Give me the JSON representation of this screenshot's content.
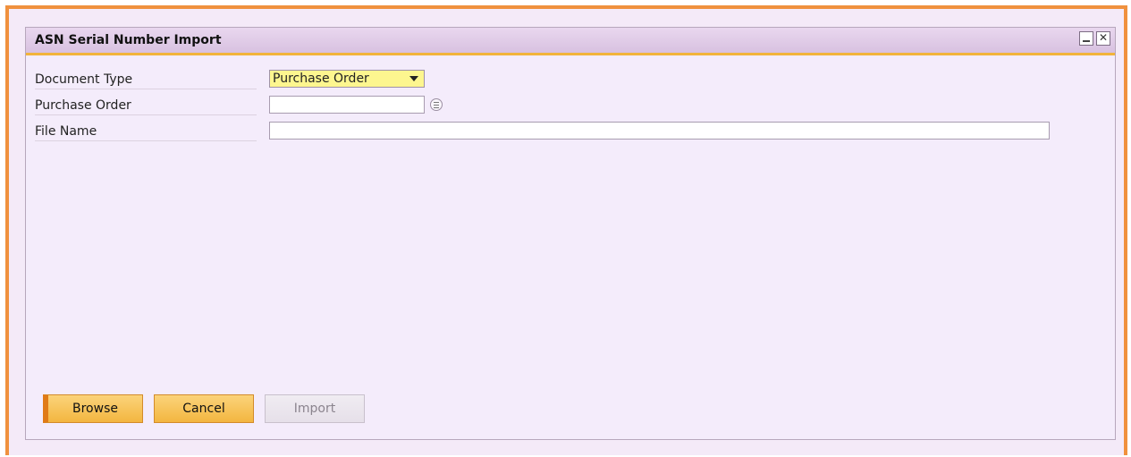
{
  "window": {
    "title": "ASN Serial Number Import",
    "controls": {
      "minimize": "minimize",
      "close": "✕"
    }
  },
  "form": {
    "document_type": {
      "label": "Document Type",
      "value": "Purchase Order"
    },
    "purchase_order": {
      "label": "Purchase Order",
      "value": ""
    },
    "file_name": {
      "label": "File Name",
      "value": ""
    }
  },
  "buttons": {
    "browse": "Browse",
    "cancel": "Cancel",
    "import": "Import"
  },
  "colors": {
    "frame_border": "#f0913e",
    "title_accent": "#f2b43a",
    "primary_button": "#f3b640",
    "select_bg": "#fdf68f"
  }
}
